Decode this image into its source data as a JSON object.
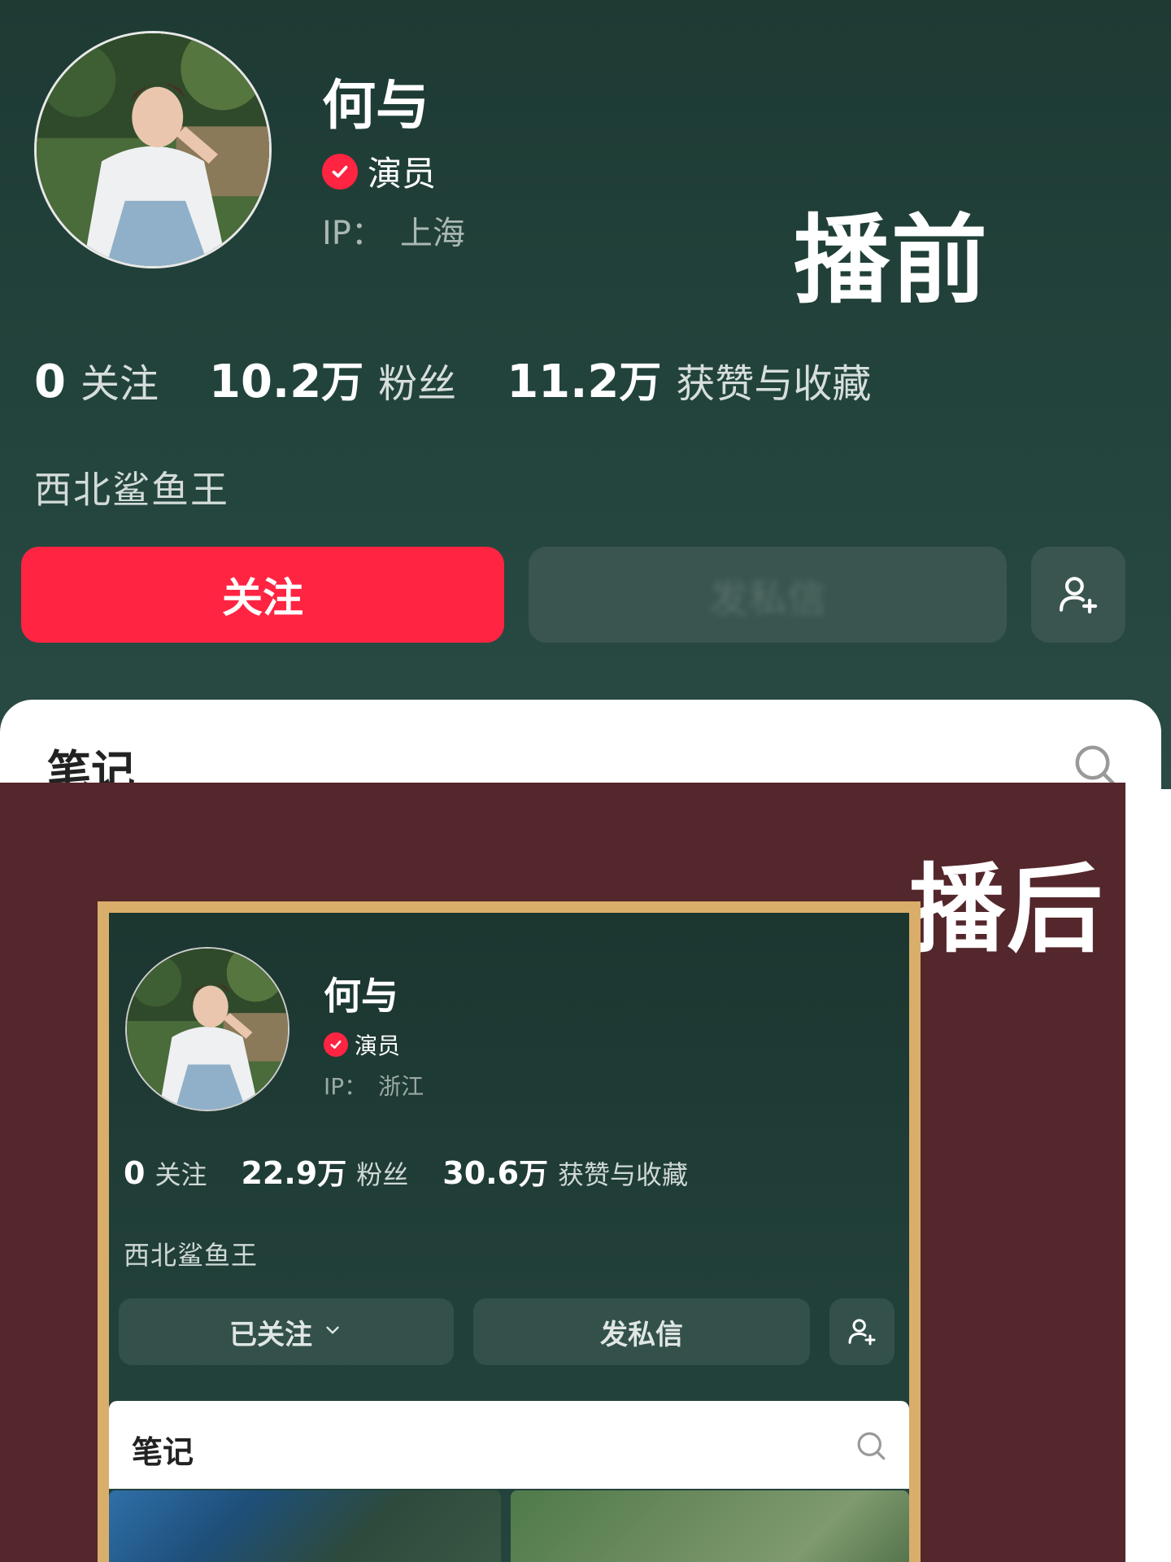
{
  "before": {
    "tag": "播前",
    "name": "何与",
    "role": "演员",
    "ip_label": "IP：",
    "ip_value": "上海",
    "stats": [
      {
        "num": "0",
        "unit": "",
        "label": "关注"
      },
      {
        "num": "10.2",
        "unit": "万",
        "label": "粉丝"
      },
      {
        "num": "11.2",
        "unit": "万",
        "label": "获赞与收藏"
      }
    ],
    "bio": "西北鲨鱼王",
    "follow_button": "关注",
    "message_button": "发私信",
    "notes_tab": "笔记",
    "accent_color": "#ff2442"
  },
  "after": {
    "tag": "播后",
    "name": "何与",
    "role": "演员",
    "ip_label": "IP：",
    "ip_value": "浙江",
    "stats": [
      {
        "num": "0",
        "unit": "",
        "label": "关注"
      },
      {
        "num": "22.9",
        "unit": "万",
        "label": "粉丝"
      },
      {
        "num": "30.6",
        "unit": "万",
        "label": "获赞与收藏"
      }
    ],
    "bio": "西北鲨鱼王",
    "followed_button": "已关注",
    "message_button": "发私信",
    "notes_tab": "笔记",
    "frame_color": "#d9ae6b",
    "background_color": "#54272c"
  },
  "icons": {
    "verified": "verified-check-icon",
    "add_friend": "add-user-icon",
    "search": "search-icon",
    "chevron": "chevron-down-icon"
  }
}
